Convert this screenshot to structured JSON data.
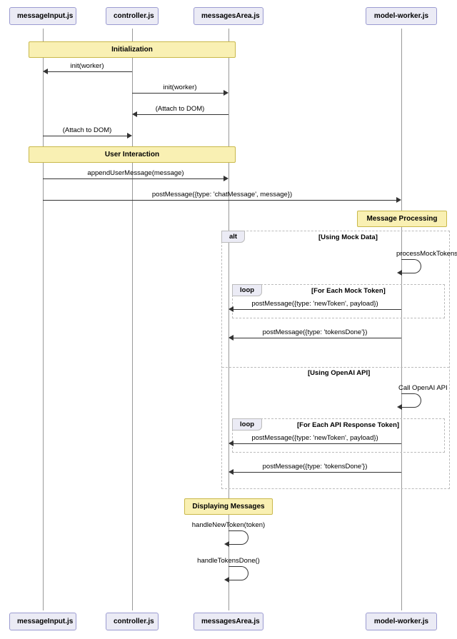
{
  "participants": {
    "p1": "messageInput.js",
    "p2": "controller.js",
    "p3": "messagesArea.js",
    "p4": "model-worker.js"
  },
  "notes": {
    "init": "Initialization",
    "user_interaction": "User Interaction",
    "msg_processing": "Message Processing",
    "displaying": "Displaying Messages"
  },
  "messages": {
    "m1": "init(worker)",
    "m2": "init(worker)",
    "m3": "(Attach to DOM)",
    "m4": "(Attach to DOM)",
    "m5": "appendUserMessage(message)",
    "m6": "postMessage({type: 'chatMessage', message})",
    "m7": "processMockTokens()",
    "m8": "postMessage({type: 'newToken', payload})",
    "m9": "postMessage({type: 'tokensDone'})",
    "m10": "Call OpenAI API",
    "m11": "postMessage({type: 'newToken', payload})",
    "m12": "postMessage({type: 'tokensDone'})",
    "m13": "handleNewToken(token)",
    "m14": "handleTokensDone()"
  },
  "alt": {
    "alt_label": "alt",
    "loop_label": "loop",
    "cond_mock": "[Using Mock Data]",
    "cond_api": "[Using OpenAI API]",
    "cond_each_mock": "[For Each Mock Token]",
    "cond_each_api": "[For Each API Response Token]"
  }
}
